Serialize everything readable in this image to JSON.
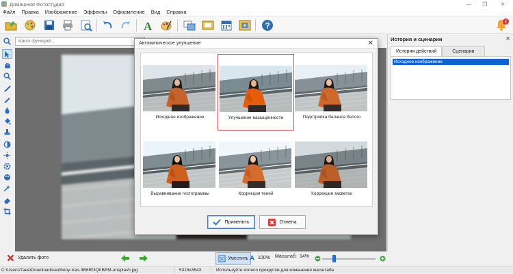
{
  "window": {
    "title": "Домашняя Фотостудия"
  },
  "menu": [
    "Файл",
    "Правка",
    "Изображение",
    "Эффекты",
    "Оформление",
    "Вид",
    "Справка"
  ],
  "notifications": {
    "count": "1"
  },
  "search": {
    "placeholder": "поиск функций..."
  },
  "dialog": {
    "title": "Автоматическое улучшение",
    "thumbnails": [
      {
        "caption": "Исходное изображение",
        "selected": false
      },
      {
        "caption": "Улучшение насыщенности",
        "selected": true
      },
      {
        "caption": "Подстройка баланса белого",
        "selected": false
      },
      {
        "caption": "Выравнивание гистограммы",
        "selected": false
      },
      {
        "caption": "Коррекция теней",
        "selected": false
      },
      {
        "caption": "Коррекция засветок",
        "selected": false
      }
    ],
    "apply_label": "Применить",
    "cancel_label": "Отмена"
  },
  "panel": {
    "title": "История и сценарии",
    "tabs": [
      "История действий",
      "Сценарии"
    ],
    "history": [
      "Исходное изображение"
    ]
  },
  "bottom": {
    "delete_label": "Удалить фото",
    "fit_label": "Уместить",
    "actual_label": "100%",
    "scale_label": "Масштаб:",
    "scale_value": "14%",
    "zoom_level": 0.14
  },
  "status": {
    "path": "C:\\Users\\Таня\\Downloads\\anthony-tran-3B6RfJQKBEM-unsplash.jpg",
    "dimensions": "5316x3543",
    "hint": "Используйте колесо прокрутки для изменения масштаба"
  },
  "colors": {
    "accent": "#0a64d6",
    "selected_border": "#d9534f",
    "canvas": "#6e6e6e"
  }
}
